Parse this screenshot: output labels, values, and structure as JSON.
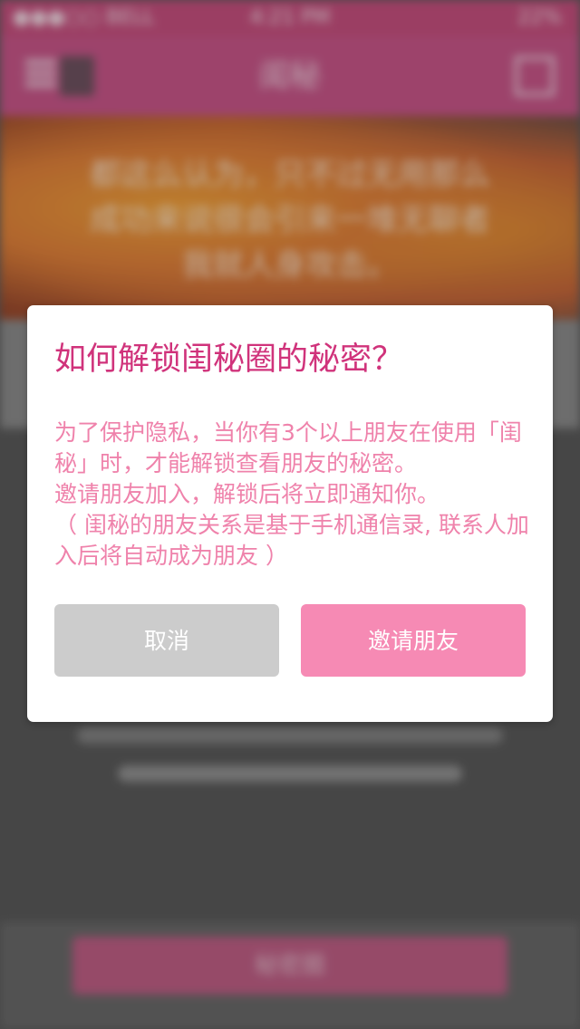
{
  "background": {
    "status_bar": {
      "carrier": "●●●○○ BELL",
      "time": "4:21 PM",
      "battery": "22%"
    },
    "nav_title": "闺秘",
    "hero_text": [
      "都这么认为，只不过无用那么",
      "成功来说很会引来一堆无聊者",
      "我就人身攻击。"
    ],
    "bottom_button_label": "秘密圈"
  },
  "dialog": {
    "title": "如何解锁闺秘圈的秘密？",
    "message": [
      "为了保护隐私，当你有3个以上朋友在使用「闺秘」时，才能解锁查看朋友的秘密。",
      "邀请朋友加入，解锁后将立即通知你。",
      "（ 闺秘的朋友关系是基于手机通信录, 联系人加入后将自动成为朋友 ）"
    ],
    "cancel_label": "取消",
    "invite_label": "邀请朋友"
  },
  "colors": {
    "title": "#d0337b",
    "message": "#ef82ab",
    "cancel_button": "#cccccc",
    "invite_button": "#f68ab4",
    "nav_bar": "#c9578a"
  }
}
